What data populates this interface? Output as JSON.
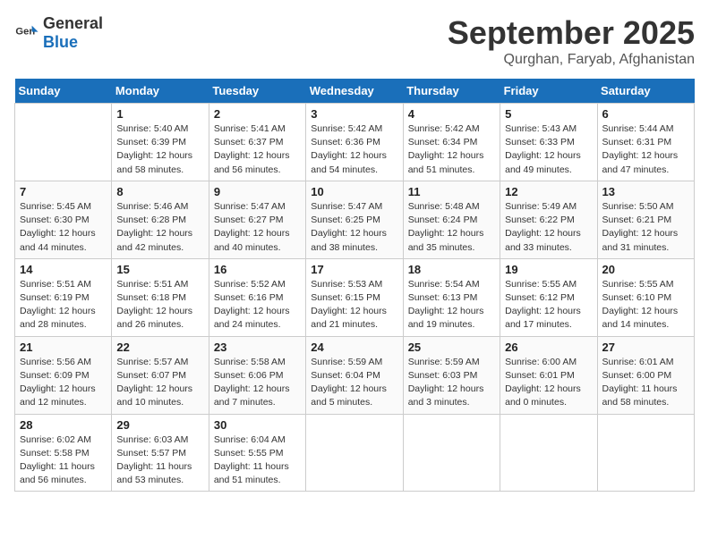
{
  "header": {
    "logo_general": "General",
    "logo_blue": "Blue",
    "month": "September 2025",
    "location": "Qurghan, Faryab, Afghanistan"
  },
  "days_of_week": [
    "Sunday",
    "Monday",
    "Tuesday",
    "Wednesday",
    "Thursday",
    "Friday",
    "Saturday"
  ],
  "weeks": [
    [
      {
        "day": "",
        "sunrise": "",
        "sunset": "",
        "daylight": ""
      },
      {
        "day": "1",
        "sunrise": "Sunrise: 5:40 AM",
        "sunset": "Sunset: 6:39 PM",
        "daylight": "Daylight: 12 hours and 58 minutes."
      },
      {
        "day": "2",
        "sunrise": "Sunrise: 5:41 AM",
        "sunset": "Sunset: 6:37 PM",
        "daylight": "Daylight: 12 hours and 56 minutes."
      },
      {
        "day": "3",
        "sunrise": "Sunrise: 5:42 AM",
        "sunset": "Sunset: 6:36 PM",
        "daylight": "Daylight: 12 hours and 54 minutes."
      },
      {
        "day": "4",
        "sunrise": "Sunrise: 5:42 AM",
        "sunset": "Sunset: 6:34 PM",
        "daylight": "Daylight: 12 hours and 51 minutes."
      },
      {
        "day": "5",
        "sunrise": "Sunrise: 5:43 AM",
        "sunset": "Sunset: 6:33 PM",
        "daylight": "Daylight: 12 hours and 49 minutes."
      },
      {
        "day": "6",
        "sunrise": "Sunrise: 5:44 AM",
        "sunset": "Sunset: 6:31 PM",
        "daylight": "Daylight: 12 hours and 47 minutes."
      }
    ],
    [
      {
        "day": "7",
        "sunrise": "Sunrise: 5:45 AM",
        "sunset": "Sunset: 6:30 PM",
        "daylight": "Daylight: 12 hours and 44 minutes."
      },
      {
        "day": "8",
        "sunrise": "Sunrise: 5:46 AM",
        "sunset": "Sunset: 6:28 PM",
        "daylight": "Daylight: 12 hours and 42 minutes."
      },
      {
        "day": "9",
        "sunrise": "Sunrise: 5:47 AM",
        "sunset": "Sunset: 6:27 PM",
        "daylight": "Daylight: 12 hours and 40 minutes."
      },
      {
        "day": "10",
        "sunrise": "Sunrise: 5:47 AM",
        "sunset": "Sunset: 6:25 PM",
        "daylight": "Daylight: 12 hours and 38 minutes."
      },
      {
        "day": "11",
        "sunrise": "Sunrise: 5:48 AM",
        "sunset": "Sunset: 6:24 PM",
        "daylight": "Daylight: 12 hours and 35 minutes."
      },
      {
        "day": "12",
        "sunrise": "Sunrise: 5:49 AM",
        "sunset": "Sunset: 6:22 PM",
        "daylight": "Daylight: 12 hours and 33 minutes."
      },
      {
        "day": "13",
        "sunrise": "Sunrise: 5:50 AM",
        "sunset": "Sunset: 6:21 PM",
        "daylight": "Daylight: 12 hours and 31 minutes."
      }
    ],
    [
      {
        "day": "14",
        "sunrise": "Sunrise: 5:51 AM",
        "sunset": "Sunset: 6:19 PM",
        "daylight": "Daylight: 12 hours and 28 minutes."
      },
      {
        "day": "15",
        "sunrise": "Sunrise: 5:51 AM",
        "sunset": "Sunset: 6:18 PM",
        "daylight": "Daylight: 12 hours and 26 minutes."
      },
      {
        "day": "16",
        "sunrise": "Sunrise: 5:52 AM",
        "sunset": "Sunset: 6:16 PM",
        "daylight": "Daylight: 12 hours and 24 minutes."
      },
      {
        "day": "17",
        "sunrise": "Sunrise: 5:53 AM",
        "sunset": "Sunset: 6:15 PM",
        "daylight": "Daylight: 12 hours and 21 minutes."
      },
      {
        "day": "18",
        "sunrise": "Sunrise: 5:54 AM",
        "sunset": "Sunset: 6:13 PM",
        "daylight": "Daylight: 12 hours and 19 minutes."
      },
      {
        "day": "19",
        "sunrise": "Sunrise: 5:55 AM",
        "sunset": "Sunset: 6:12 PM",
        "daylight": "Daylight: 12 hours and 17 minutes."
      },
      {
        "day": "20",
        "sunrise": "Sunrise: 5:55 AM",
        "sunset": "Sunset: 6:10 PM",
        "daylight": "Daylight: 12 hours and 14 minutes."
      }
    ],
    [
      {
        "day": "21",
        "sunrise": "Sunrise: 5:56 AM",
        "sunset": "Sunset: 6:09 PM",
        "daylight": "Daylight: 12 hours and 12 minutes."
      },
      {
        "day": "22",
        "sunrise": "Sunrise: 5:57 AM",
        "sunset": "Sunset: 6:07 PM",
        "daylight": "Daylight: 12 hours and 10 minutes."
      },
      {
        "day": "23",
        "sunrise": "Sunrise: 5:58 AM",
        "sunset": "Sunset: 6:06 PM",
        "daylight": "Daylight: 12 hours and 7 minutes."
      },
      {
        "day": "24",
        "sunrise": "Sunrise: 5:59 AM",
        "sunset": "Sunset: 6:04 PM",
        "daylight": "Daylight: 12 hours and 5 minutes."
      },
      {
        "day": "25",
        "sunrise": "Sunrise: 5:59 AM",
        "sunset": "Sunset: 6:03 PM",
        "daylight": "Daylight: 12 hours and 3 minutes."
      },
      {
        "day": "26",
        "sunrise": "Sunrise: 6:00 AM",
        "sunset": "Sunset: 6:01 PM",
        "daylight": "Daylight: 12 hours and 0 minutes."
      },
      {
        "day": "27",
        "sunrise": "Sunrise: 6:01 AM",
        "sunset": "Sunset: 6:00 PM",
        "daylight": "Daylight: 11 hours and 58 minutes."
      }
    ],
    [
      {
        "day": "28",
        "sunrise": "Sunrise: 6:02 AM",
        "sunset": "Sunset: 5:58 PM",
        "daylight": "Daylight: 11 hours and 56 minutes."
      },
      {
        "day": "29",
        "sunrise": "Sunrise: 6:03 AM",
        "sunset": "Sunset: 5:57 PM",
        "daylight": "Daylight: 11 hours and 53 minutes."
      },
      {
        "day": "30",
        "sunrise": "Sunrise: 6:04 AM",
        "sunset": "Sunset: 5:55 PM",
        "daylight": "Daylight: 11 hours and 51 minutes."
      },
      {
        "day": "",
        "sunrise": "",
        "sunset": "",
        "daylight": ""
      },
      {
        "day": "",
        "sunrise": "",
        "sunset": "",
        "daylight": ""
      },
      {
        "day": "",
        "sunrise": "",
        "sunset": "",
        "daylight": ""
      },
      {
        "day": "",
        "sunrise": "",
        "sunset": "",
        "daylight": ""
      }
    ]
  ]
}
